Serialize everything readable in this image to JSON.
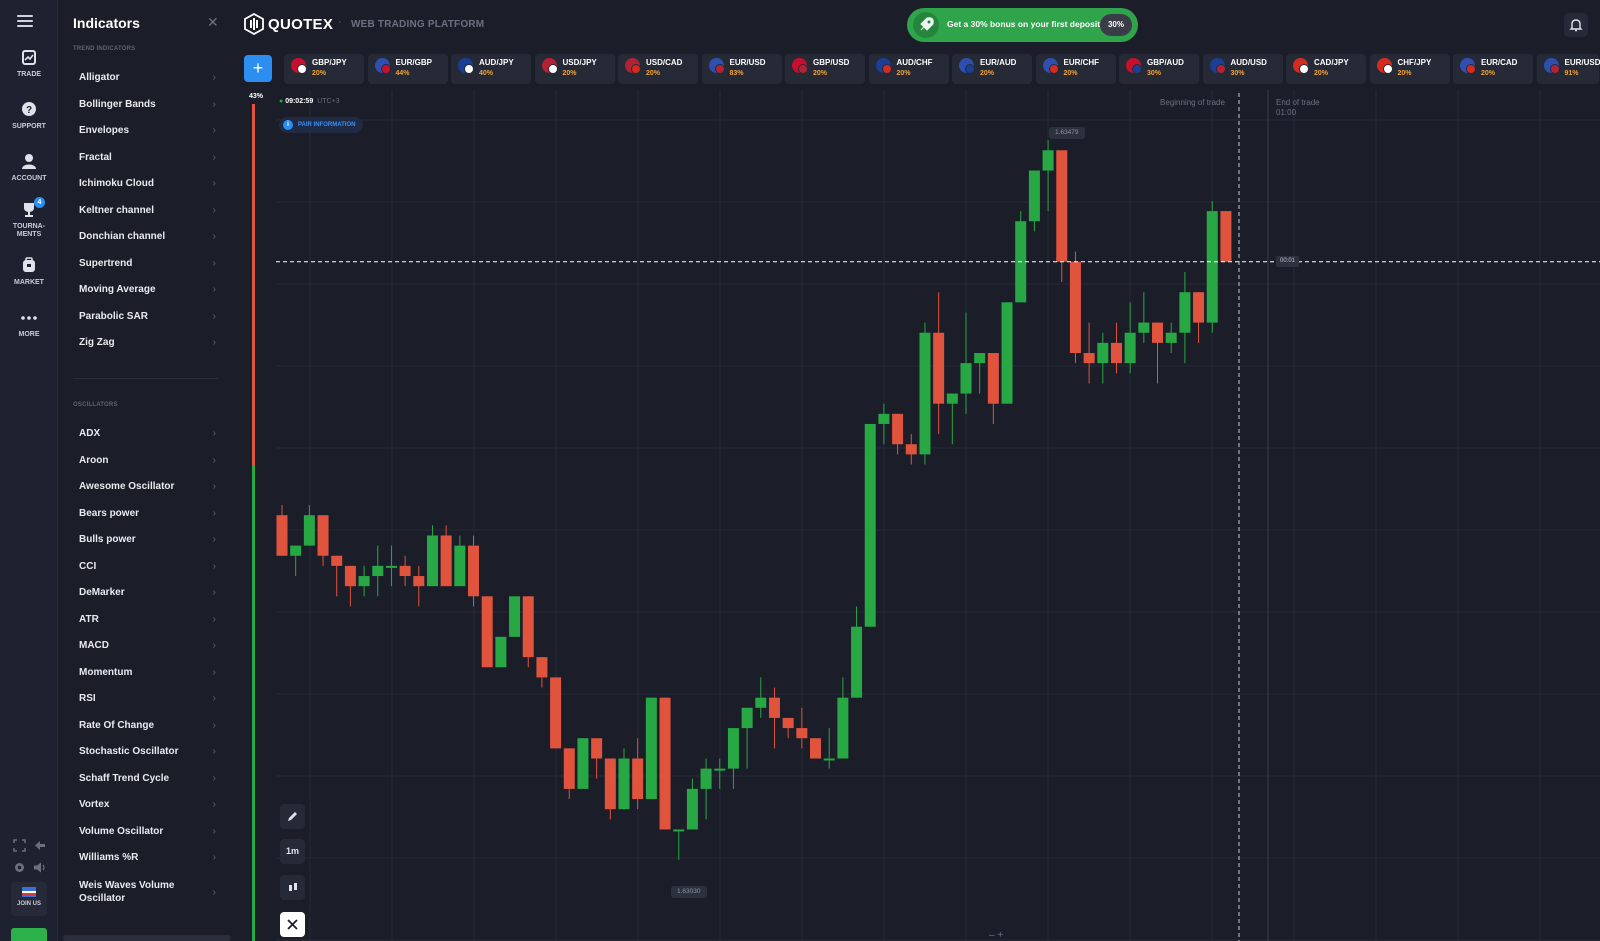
{
  "nav": {
    "items": [
      {
        "key": "trade",
        "label": "TRADE",
        "icon": "chart-icon"
      },
      {
        "key": "support",
        "label": "SUPPORT",
        "icon": "help-icon"
      },
      {
        "key": "account",
        "label": "ACCOUNT",
        "icon": "user-icon"
      },
      {
        "key": "tournaments",
        "label": "TOURNA-\nMENTS",
        "icon": "trophy-icon",
        "badge": "4"
      },
      {
        "key": "market",
        "label": "MARKET",
        "icon": "market-icon"
      },
      {
        "key": "more",
        "label": "MORE",
        "icon": "dots-icon"
      }
    ],
    "join_label": "JOIN US"
  },
  "indicators_panel": {
    "title": "Indicators",
    "close_glyph": "✕",
    "trend_title": "TREND INDICATORS",
    "trend": [
      "Alligator",
      "Bollinger Bands",
      "Envelopes",
      "Fractal",
      "Ichimoku Cloud",
      "Keltner channel",
      "Donchian channel",
      "Supertrend",
      "Moving Average",
      "Parabolic SAR",
      "Zig Zag"
    ],
    "osc_title": "OSCILLATORS",
    "oscillators": [
      "ADX",
      "Aroon",
      "Awesome Oscillator",
      "Bears power",
      "Bulls power",
      "CCI",
      "DeMarker",
      "ATR",
      "MACD",
      "Momentum",
      "RSI",
      "Rate Of Change",
      "Stochastic Oscillator",
      "Schaff Trend Cycle",
      "Vortex",
      "Volume Oscillator",
      "Williams %R"
    ],
    "last_item": "Weis Waves Volume Oscillator"
  },
  "header": {
    "brand": "QUOTEX",
    "platform": "WEB TRADING PLATFORM",
    "bonus_text": "Get a 30% bonus on your first deposit",
    "bonus_pct": "30%"
  },
  "pairs": [
    {
      "name": "GBP/JPY",
      "pct": "20%",
      "c1": "#c8102e",
      "c2": "#ffffff"
    },
    {
      "name": "EUR/GBP",
      "pct": "44%",
      "c1": "#2f4fb0",
      "c2": "#c8102e"
    },
    {
      "name": "AUD/JPY",
      "pct": "40%",
      "c1": "#1c3f94",
      "c2": "#ffffff"
    },
    {
      "name": "USD/JPY",
      "pct": "20%",
      "c1": "#b22234",
      "c2": "#ffffff"
    },
    {
      "name": "USD/CAD",
      "pct": "20%",
      "c1": "#b22234",
      "c2": "#d52b1e"
    },
    {
      "name": "EUR/USD",
      "pct": "83%",
      "c1": "#2f4fb0",
      "c2": "#b22234"
    },
    {
      "name": "GBP/USD",
      "pct": "20%",
      "c1": "#c8102e",
      "c2": "#b22234"
    },
    {
      "name": "AUD/CHF",
      "pct": "20%",
      "c1": "#1c3f94",
      "c2": "#d52b1e"
    },
    {
      "name": "EUR/AUD",
      "pct": "20%",
      "c1": "#2f4fb0",
      "c2": "#1c3f94"
    },
    {
      "name": "EUR/CHF",
      "pct": "20%",
      "c1": "#2f4fb0",
      "c2": "#d52b1e"
    },
    {
      "name": "GBP/AUD",
      "pct": "30%",
      "c1": "#c8102e",
      "c2": "#1c3f94"
    },
    {
      "name": "AUD/USD",
      "pct": "30%",
      "c1": "#1c3f94",
      "c2": "#b22234"
    },
    {
      "name": "CAD/JPY",
      "pct": "20%",
      "c1": "#d52b1e",
      "c2": "#ffffff"
    },
    {
      "name": "CHF/JPY",
      "pct": "20%",
      "c1": "#d52b1e",
      "c2": "#ffffff"
    },
    {
      "name": "EUR/CAD",
      "pct": "20%",
      "c1": "#2f4fb0",
      "c2": "#d52b1e"
    },
    {
      "name": "EUR/USD",
      "pct": "91%",
      "c1": "#2f4fb0",
      "c2": "#b22234"
    }
  ],
  "chart": {
    "sentiment_pct": "43%",
    "time": "09:02:59",
    "timezone": "UTC+3",
    "pair_info": "PAIR INFORMATION",
    "begin_trade": "Beginning of trade",
    "end_trade": "End of trade",
    "end_time": "01:00",
    "timer": "00:01",
    "high_label": "1.63479",
    "low_label": "1.63030",
    "timeframe": "1m",
    "zoom": "– +",
    "colors": {
      "up": "#27a844",
      "down": "#e0533d",
      "grid": "#262a36",
      "bg": "#1b1e29"
    }
  },
  "chart_data": {
    "type": "candlestick",
    "title": "",
    "ohlc": [
      [
        1.6325,
        1.6326,
        1.6321,
        1.6321
      ],
      [
        1.6321,
        1.6321,
        1.6319,
        1.6322
      ],
      [
        1.6322,
        1.6326,
        1.6322,
        1.6325
      ],
      [
        1.6325,
        1.6325,
        1.632,
        1.6321
      ],
      [
        1.6321,
        1.6321,
        1.6317,
        1.632
      ],
      [
        1.632,
        1.632,
        1.6316,
        1.6318
      ],
      [
        1.6318,
        1.632,
        1.6317,
        1.6319
      ],
      [
        1.6319,
        1.6322,
        1.6317,
        1.632
      ],
      [
        1.632,
        1.6322,
        1.6318,
        1.632
      ],
      [
        1.632,
        1.6321,
        1.6318,
        1.6319
      ],
      [
        1.6319,
        1.632,
        1.6316,
        1.6318
      ],
      [
        1.6318,
        1.6324,
        1.6318,
        1.6323
      ],
      [
        1.6323,
        1.6324,
        1.6318,
        1.6318
      ],
      [
        1.6318,
        1.6323,
        1.6318,
        1.6322
      ],
      [
        1.6322,
        1.6323,
        1.6316,
        1.6317
      ],
      [
        1.6317,
        1.6317,
        1.631,
        1.631
      ],
      [
        1.631,
        1.6313,
        1.631,
        1.6313
      ],
      [
        1.6313,
        1.6317,
        1.6313,
        1.6317
      ],
      [
        1.6317,
        1.6317,
        1.631,
        1.6311
      ],
      [
        1.6311,
        1.6311,
        1.6308,
        1.6309
      ],
      [
        1.6309,
        1.6309,
        1.6302,
        1.6302
      ],
      [
        1.6302,
        1.6302,
        1.6297,
        1.6298
      ],
      [
        1.6298,
        1.6303,
        1.6298,
        1.6303
      ],
      [
        1.6303,
        1.6303,
        1.6299,
        1.6301
      ],
      [
        1.6301,
        1.6301,
        1.6295,
        1.6296
      ],
      [
        1.6296,
        1.6302,
        1.6296,
        1.6301
      ],
      [
        1.6301,
        1.6303,
        1.6296,
        1.6297
      ],
      [
        1.6297,
        1.6307,
        1.6297,
        1.6307
      ],
      [
        1.6307,
        1.6307,
        1.6294,
        1.6294
      ],
      [
        1.6294,
        1.6294,
        1.6291,
        1.6294
      ],
      [
        1.6294,
        1.6299,
        1.6294,
        1.6298
      ],
      [
        1.6298,
        1.6301,
        1.6295,
        1.63
      ],
      [
        1.63,
        1.6301,
        1.6298,
        1.63
      ],
      [
        1.63,
        1.6304,
        1.6298,
        1.6304
      ],
      [
        1.6304,
        1.6306,
        1.63,
        1.6306
      ],
      [
        1.6306,
        1.6309,
        1.6305,
        1.6307
      ],
      [
        1.6307,
        1.6308,
        1.6302,
        1.6305
      ],
      [
        1.6305,
        1.6305,
        1.6303,
        1.6304
      ],
      [
        1.6304,
        1.6306,
        1.6302,
        1.6303
      ],
      [
        1.6303,
        1.6303,
        1.6301,
        1.6301
      ],
      [
        1.6301,
        1.6304,
        1.63,
        1.6301
      ],
      [
        1.6301,
        1.6309,
        1.6301,
        1.6307
      ],
      [
        1.6307,
        1.6316,
        1.6307,
        1.6314
      ],
      [
        1.6314,
        1.6334,
        1.6314,
        1.6334
      ],
      [
        1.6334,
        1.6336,
        1.6332,
        1.6335
      ],
      [
        1.6335,
        1.6335,
        1.6331,
        1.6332
      ],
      [
        1.6332,
        1.6333,
        1.633,
        1.6331
      ],
      [
        1.6331,
        1.6344,
        1.633,
        1.6343
      ],
      [
        1.6343,
        1.6347,
        1.6333,
        1.6336
      ],
      [
        1.6336,
        1.6337,
        1.6332,
        1.6337
      ],
      [
        1.6337,
        1.6345,
        1.6335,
        1.634
      ],
      [
        1.634,
        1.6341,
        1.6337,
        1.6341
      ],
      [
        1.6341,
        1.6341,
        1.6334,
        1.6336
      ],
      [
        1.6336,
        1.6346,
        1.6336,
        1.6346
      ],
      [
        1.6346,
        1.6355,
        1.6346,
        1.6354
      ],
      [
        1.6354,
        1.6359,
        1.6353,
        1.6359
      ],
      [
        1.6359,
        1.6362,
        1.6355,
        1.6361
      ],
      [
        1.6361,
        1.6361,
        1.6348,
        1.635
      ],
      [
        1.635,
        1.6351,
        1.634,
        1.6341
      ],
      [
        1.6341,
        1.6344,
        1.6338,
        1.634
      ],
      [
        1.634,
        1.6343,
        1.6338,
        1.6342
      ],
      [
        1.6342,
        1.6344,
        1.6339,
        1.634
      ],
      [
        1.634,
        1.6346,
        1.6339,
        1.6343
      ],
      [
        1.6343,
        1.6347,
        1.6342,
        1.6344
      ],
      [
        1.6344,
        1.6344,
        1.6338,
        1.6342
      ],
      [
        1.6342,
        1.6344,
        1.6341,
        1.6343
      ],
      [
        1.6343,
        1.6349,
        1.634,
        1.6347
      ],
      [
        1.6347,
        1.6347,
        1.6342,
        1.6344
      ],
      [
        1.6344,
        1.6356,
        1.6343,
        1.6355
      ],
      [
        1.6355,
        1.6355,
        1.635,
        1.635
      ]
    ],
    "ylim": [
      1.629,
      1.6363
    ],
    "current_price": 1.635,
    "xlabel": "",
    "ylabel": "",
    "grid": true
  }
}
